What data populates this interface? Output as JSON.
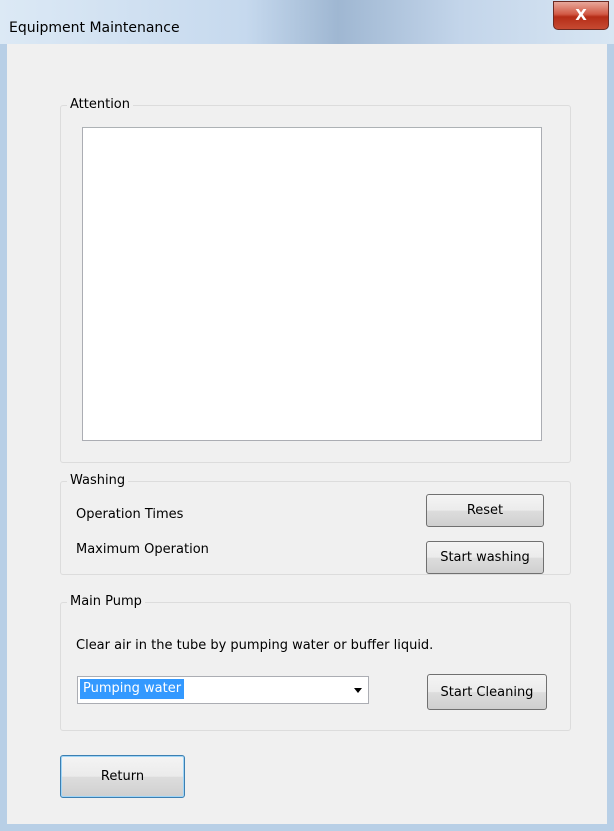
{
  "window": {
    "title": "Equipment Maintenance",
    "close_glyph": "X"
  },
  "attention": {
    "label": "Attention",
    "content": ""
  },
  "washing": {
    "label": "Washing",
    "operation_times_label": "Operation Times",
    "maximum_operation_label": "Maximum Operation",
    "reset_button": "Reset",
    "start_washing_button": "Start washing"
  },
  "main_pump": {
    "label": "Main Pump",
    "instruction": "Clear air in the tube by pumping water or buffer liquid.",
    "mode_selected": "Pumping water",
    "start_cleaning_button": "Start Cleaning"
  },
  "footer": {
    "return_button": "Return"
  },
  "colors": {
    "selection_highlight": "#3399ff",
    "close_button_red": "#c64a32",
    "window_frame": "#b8cfe6"
  },
  "icons": {
    "close": "close-icon",
    "dropdown": "chevron-down-icon"
  }
}
